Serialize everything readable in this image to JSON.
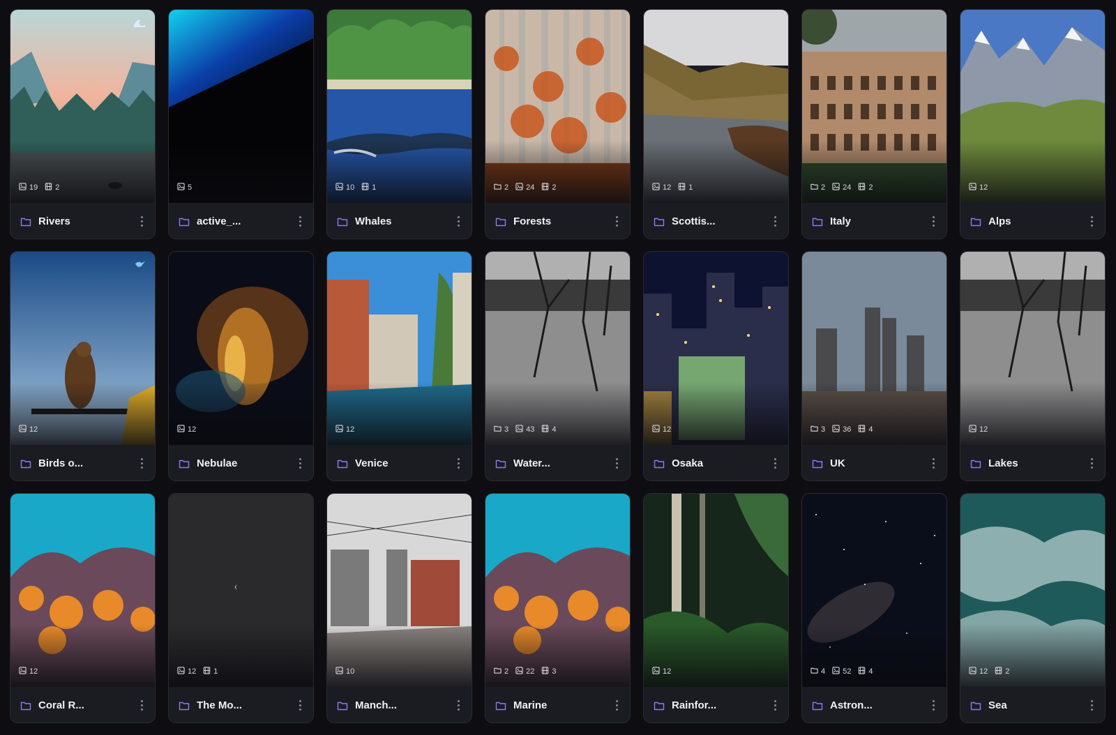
{
  "accent": "#8b7cf6",
  "albums": [
    {
      "name": "Rivers",
      "badge": "wave-icon",
      "stats": [
        {
          "icon": "image-icon",
          "value": "19"
        },
        {
          "icon": "film-icon",
          "value": "2"
        }
      ],
      "scene": "rivers"
    },
    {
      "name": "active_...",
      "badge": null,
      "stats": [
        {
          "icon": "image-icon",
          "value": "5"
        }
      ],
      "scene": "active"
    },
    {
      "name": "Whales",
      "badge": null,
      "stats": [
        {
          "icon": "image-icon",
          "value": "10"
        },
        {
          "icon": "film-icon",
          "value": "1"
        }
      ],
      "scene": "whales"
    },
    {
      "name": "Forests",
      "badge": null,
      "stats": [
        {
          "icon": "folder-icon",
          "value": "2"
        },
        {
          "icon": "image-icon",
          "value": "24"
        },
        {
          "icon": "film-icon",
          "value": "2"
        }
      ],
      "scene": "forests"
    },
    {
      "name": "Scottis...",
      "badge": null,
      "stats": [
        {
          "icon": "image-icon",
          "value": "12"
        },
        {
          "icon": "film-icon",
          "value": "1"
        }
      ],
      "scene": "scottish"
    },
    {
      "name": "Italy",
      "badge": null,
      "stats": [
        {
          "icon": "folder-icon",
          "value": "2"
        },
        {
          "icon": "image-icon",
          "value": "24"
        },
        {
          "icon": "film-icon",
          "value": "2"
        }
      ],
      "scene": "italy"
    },
    {
      "name": "Alps",
      "badge": null,
      "stats": [
        {
          "icon": "image-icon",
          "value": "12"
        }
      ],
      "scene": "alps"
    },
    {
      "name": "Birds o...",
      "badge": "bird-icon",
      "stats": [
        {
          "icon": "image-icon",
          "value": "12"
        }
      ],
      "scene": "birds"
    },
    {
      "name": "Nebulae",
      "badge": null,
      "stats": [
        {
          "icon": "image-icon",
          "value": "12"
        }
      ],
      "scene": "nebulae"
    },
    {
      "name": "Venice",
      "badge": null,
      "stats": [
        {
          "icon": "image-icon",
          "value": "12"
        }
      ],
      "scene": "venice"
    },
    {
      "name": "Water...",
      "badge": null,
      "stats": [
        {
          "icon": "folder-icon",
          "value": "3"
        },
        {
          "icon": "image-icon",
          "value": "43"
        },
        {
          "icon": "film-icon",
          "value": "4"
        }
      ],
      "scene": "water"
    },
    {
      "name": "Osaka",
      "badge": null,
      "stats": [
        {
          "icon": "image-icon",
          "value": "12"
        }
      ],
      "scene": "osaka"
    },
    {
      "name": "UK",
      "badge": null,
      "stats": [
        {
          "icon": "folder-icon",
          "value": "3"
        },
        {
          "icon": "image-icon",
          "value": "36"
        },
        {
          "icon": "film-icon",
          "value": "4"
        }
      ],
      "scene": "uk"
    },
    {
      "name": "Lakes",
      "badge": null,
      "stats": [
        {
          "icon": "image-icon",
          "value": "12"
        }
      ],
      "scene": "water"
    },
    {
      "name": "Coral R...",
      "badge": null,
      "stats": [
        {
          "icon": "image-icon",
          "value": "12"
        }
      ],
      "scene": "coral"
    },
    {
      "name": "The Mo...",
      "badge": null,
      "stats": [
        {
          "icon": "image-icon",
          "value": "12"
        },
        {
          "icon": "film-icon",
          "value": "1"
        }
      ],
      "scene": "moon"
    },
    {
      "name": "Manch...",
      "badge": null,
      "stats": [
        {
          "icon": "image-icon",
          "value": "10"
        }
      ],
      "scene": "manchester"
    },
    {
      "name": "Marine",
      "badge": null,
      "stats": [
        {
          "icon": "folder-icon",
          "value": "2"
        },
        {
          "icon": "image-icon",
          "value": "22"
        },
        {
          "icon": "film-icon",
          "value": "3"
        }
      ],
      "scene": "coral"
    },
    {
      "name": "Rainfor...",
      "badge": null,
      "stats": [
        {
          "icon": "image-icon",
          "value": "12"
        }
      ],
      "scene": "rainforest"
    },
    {
      "name": "Astron...",
      "badge": null,
      "stats": [
        {
          "icon": "folder-icon",
          "value": "4"
        },
        {
          "icon": "image-icon",
          "value": "52"
        },
        {
          "icon": "film-icon",
          "value": "4"
        }
      ],
      "scene": "astro"
    },
    {
      "name": "Sea",
      "badge": null,
      "stats": [
        {
          "icon": "image-icon",
          "value": "12"
        },
        {
          "icon": "film-icon",
          "value": "2"
        }
      ],
      "scene": "sea"
    }
  ]
}
